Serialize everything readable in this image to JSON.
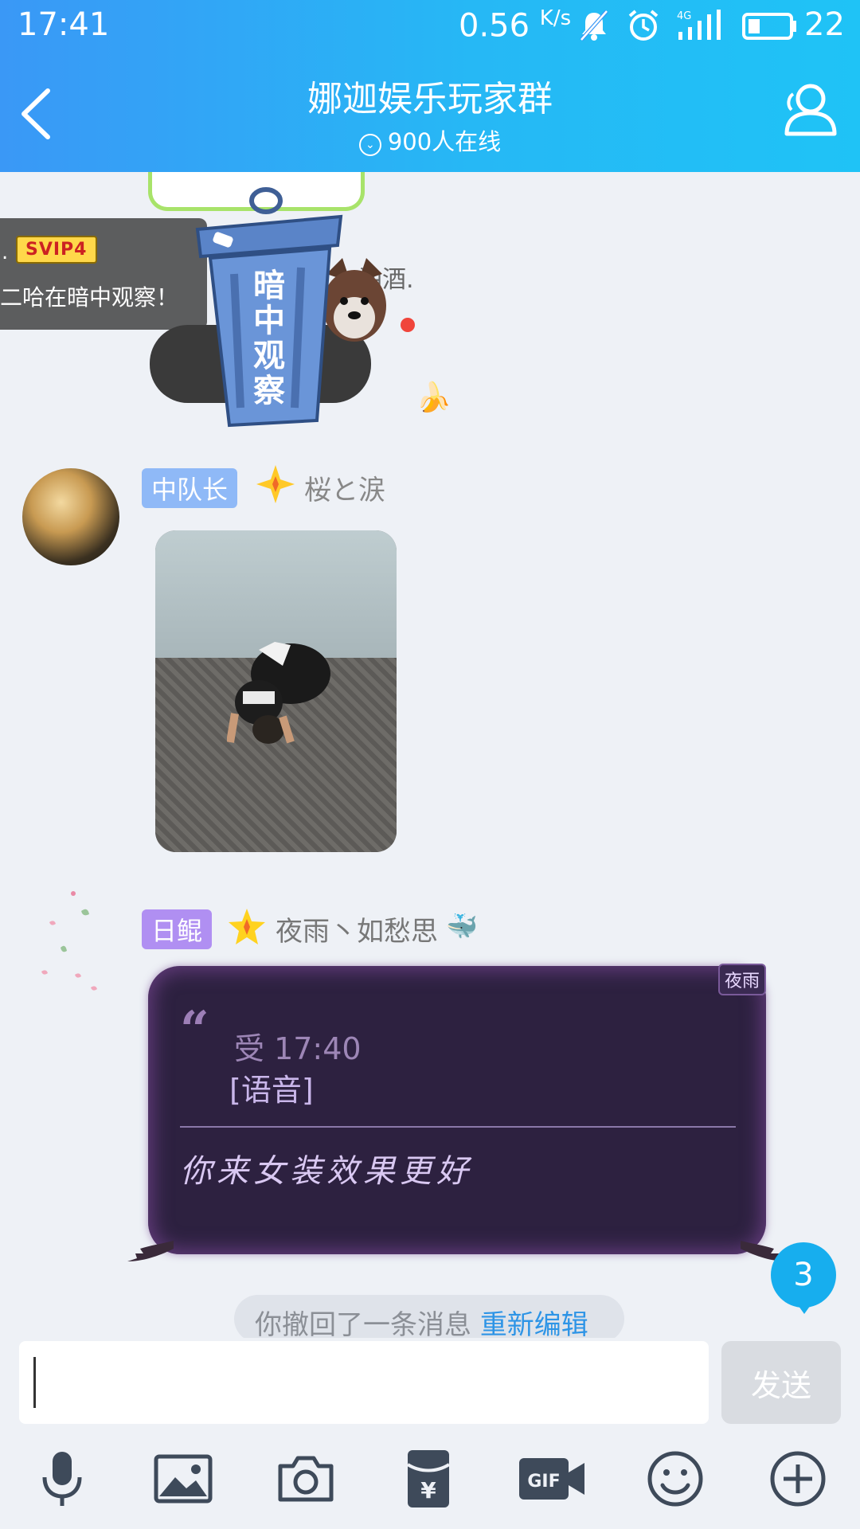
{
  "status_bar": {
    "time": "17:41",
    "net_speed": "0.56",
    "net_unit": "K/s",
    "battery": "22"
  },
  "header": {
    "title": "娜迦娱乐玩家群",
    "online": "900人在线"
  },
  "sticker_area": {
    "vip_dot": ".",
    "vip_badge": "SVIP4",
    "vip_text": "二哈在暗中观察！",
    "partial_text": "油酒.",
    "trash_text": "暗中观察"
  },
  "message1": {
    "tag": "中队长",
    "sender": "桜と涙",
    "image_alt": "photo"
  },
  "message2": {
    "tag": "日鲲",
    "sender": "夜雨丶如愁思",
    "bubble_tag": "夜雨",
    "quote_meta": "受 17:40",
    "quote_content": "[语音]",
    "text": "你来女装效果更好"
  },
  "unread_count": "3",
  "recall": {
    "text": "你撤回了一条消息",
    "link": "重新编辑"
  },
  "input": {
    "value": "",
    "send_label": "发送"
  },
  "toolbar": {
    "items": [
      "mic-icon",
      "image-icon",
      "camera-icon",
      "red-packet-icon",
      "gif-icon",
      "emoji-icon",
      "plus-icon"
    ]
  },
  "colors": {
    "header_start": "#3a98f6",
    "header_end": "#1fc3f6",
    "bubble_bg": "#2d2140",
    "link": "#2d94e6",
    "badge": "#17aeee"
  }
}
